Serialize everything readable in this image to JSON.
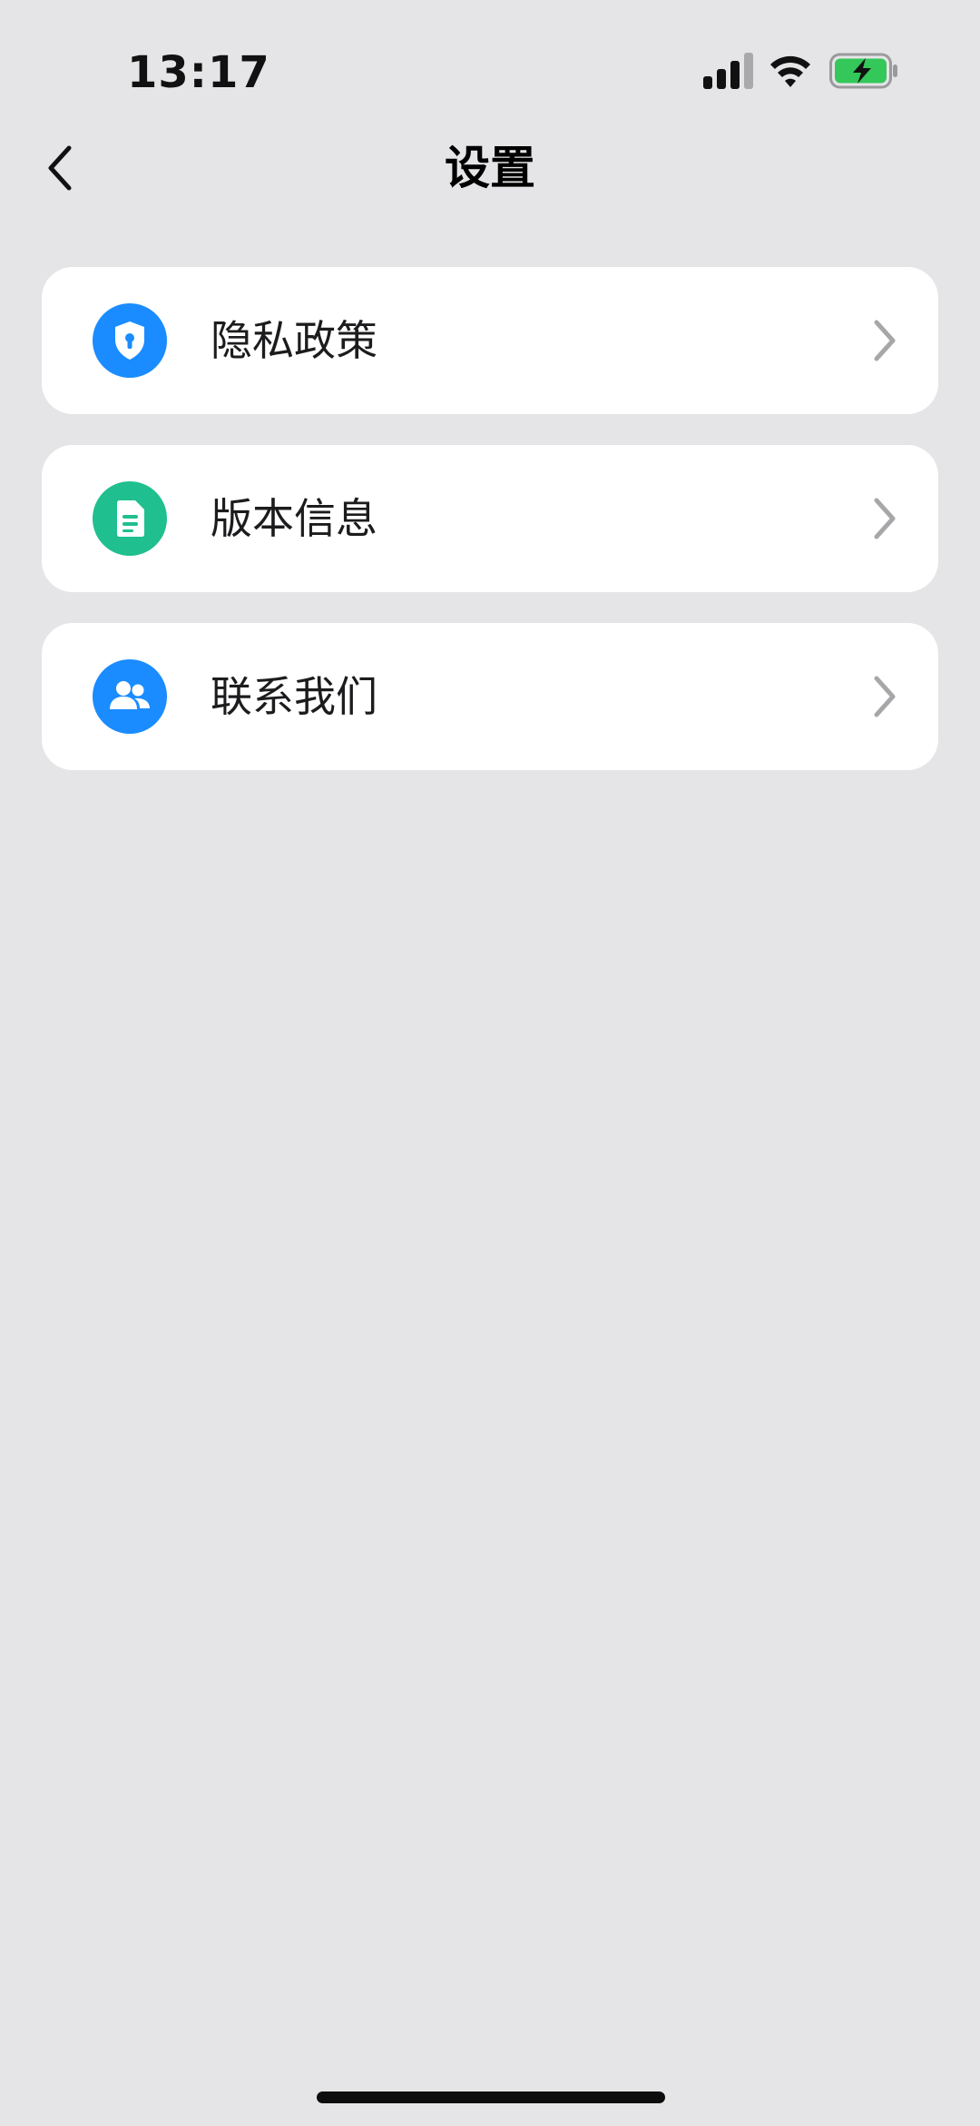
{
  "status_bar": {
    "time": "13:17",
    "signal_icon": "signal-bars-icon",
    "wifi_icon": "wifi-icon",
    "battery_icon": "battery-charging-icon",
    "battery_color": "#34c759"
  },
  "nav": {
    "back_icon": "chevron-left-icon",
    "title": "设置"
  },
  "settings": {
    "items": [
      {
        "label": "隐私政策",
        "icon": "shield-lock-icon",
        "icon_color": "#1a8cff"
      },
      {
        "label": "版本信息",
        "icon": "document-icon",
        "icon_color": "#1fbf8f"
      },
      {
        "label": "联系我们",
        "icon": "people-icon",
        "icon_color": "#1a8cff"
      }
    ],
    "chevron_icon": "chevron-right-icon"
  },
  "colors": {
    "background": "#e5e5e7",
    "card": "#ffffff",
    "chevron": "#a7a7aa"
  }
}
